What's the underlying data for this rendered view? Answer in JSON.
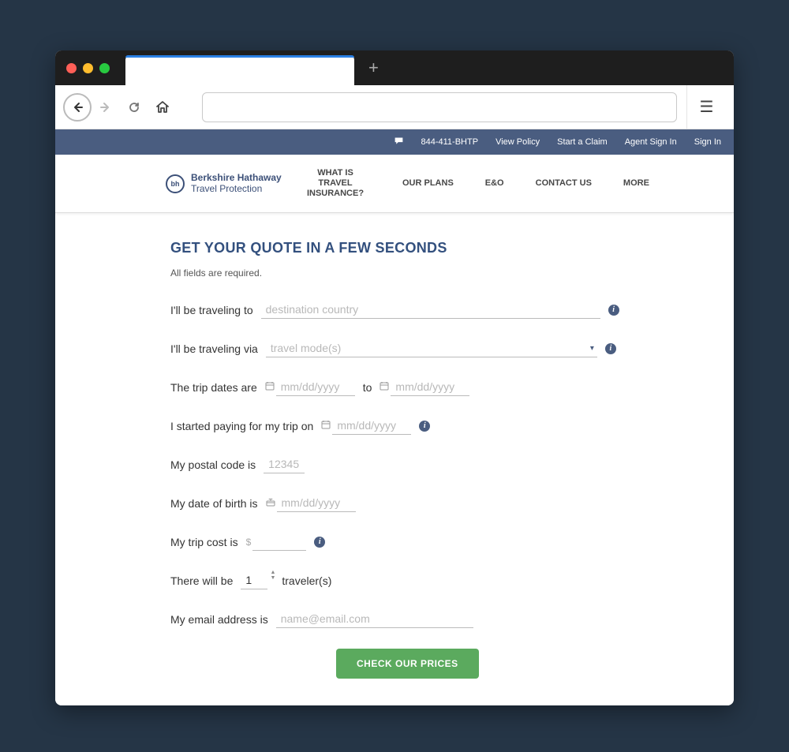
{
  "topbar": {
    "phone": "844-411-BHTP",
    "links": [
      "View Policy",
      "Start a Claim",
      "Agent Sign In",
      "Sign In"
    ]
  },
  "brand": {
    "line1": "Berkshire Hathaway",
    "line2": "Travel Protection",
    "logo_text": "bh"
  },
  "mainnav": [
    "WHAT IS TRAVEL INSURANCE?",
    "OUR PLANS",
    "E&O",
    "CONTACT US",
    "MORE"
  ],
  "form": {
    "heading": "GET YOUR QUOTE IN A FEW SECONDS",
    "required_note": "All fields are required.",
    "labels": {
      "dest": "I'll be traveling to",
      "mode": "I'll be traveling via",
      "dates": "The trip dates are",
      "dates_to": "to",
      "paydate": "I started paying for my trip on",
      "postal": "My postal code is",
      "dob": "My date of birth is",
      "cost": "My trip cost is",
      "travelers_pre": "There will be",
      "travelers_post": "traveler(s)",
      "email": "My email address is"
    },
    "placeholders": {
      "dest": "destination country",
      "mode": "travel mode(s)",
      "date": "mm/dd/yyyy",
      "postal": "12345",
      "email": "name@email.com"
    },
    "values": {
      "travelers": "1",
      "currency": "$"
    },
    "submit": "CHECK OUR PRICES"
  },
  "icons": {
    "info": "i",
    "caret": "▾"
  }
}
